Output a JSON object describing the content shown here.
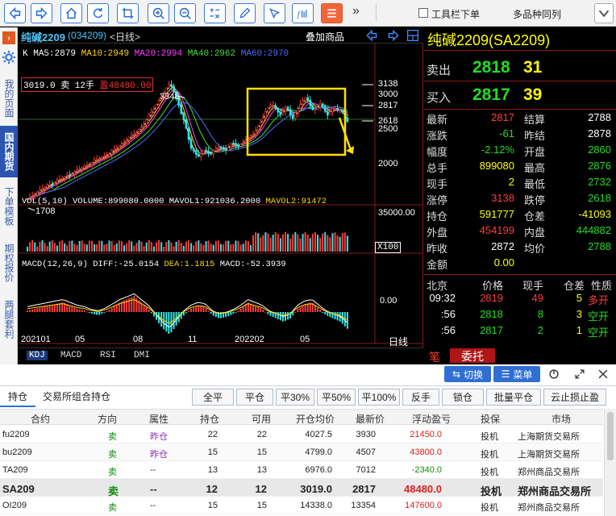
{
  "toolbar": {
    "more": "»",
    "checkbox_label": "工具栏下单",
    "multi_label": "多品种同列",
    "icons": [
      "arrow-left-icon",
      "arrow-right-icon",
      "home-icon",
      "refresh-icon",
      "crop-icon",
      "zoom-in-icon",
      "zoom-out-icon",
      "formula-icon",
      "pencil-icon",
      "pin-icon",
      "fx-icon",
      "list-icon"
    ]
  },
  "sidebar": {
    "items": [
      "我的页面",
      "国内期货",
      "下单模板",
      "期权报价",
      "两腿套利"
    ]
  },
  "chart": {
    "symbol_title": "纯碱2209",
    "symbol_code": "(034209)",
    "period_tag": "<日线>",
    "overlay_label": "叠加商品",
    "ma_legend": {
      "k": "K",
      "ma5": "MA5:2879",
      "ma10": "MA10:2949",
      "ma20": "MA20:2994",
      "ma40": "MA40:2962",
      "ma60": "MA60:2970"
    },
    "position_tag": {
      "text": "3019.0 卖 12手",
      "pnl": "盈48480.00"
    },
    "high_label": "3348",
    "low_label": "1708",
    "price_ticks": [
      "3138",
      "3000",
      "2817",
      "2618",
      "2500",
      "2000"
    ],
    "vol_legend": {
      "a": "VOL(5,10) VOLUME:899080.0000 MAVOL1:921036.2000",
      "b": "MAVOL2:91472"
    },
    "vol_tick": "35000.00",
    "vol_scale": "X100",
    "macd_legend": {
      "a": "MACD(12,26,9) DIFF:-25.0154",
      "dea": "DEA:1.1815",
      "macd": "MACD:-52.3939"
    },
    "macd_tick": "0.00",
    "x_labels": [
      "202101",
      "05",
      "08",
      "11",
      "202202",
      "05"
    ],
    "period_label": "日线",
    "indicator_tabs": [
      "KDJ",
      "MACD",
      "RSI",
      "DMI"
    ]
  },
  "chart_data": {
    "type": "candlestick",
    "title": "纯碱2209",
    "x_ticks": [
      "202101",
      "05",
      "08",
      "11",
      "202202",
      "05"
    ],
    "y_ticks": [
      2000,
      2500,
      3000
    ],
    "annotations": {
      "high": 3348,
      "low": 1708,
      "levels": [
        3138,
        3000,
        2817,
        2618
      ]
    },
    "price_path": [
      1708,
      1780,
      1850,
      1900,
      1950,
      2000,
      2050,
      2100,
      2150,
      2200,
      2260,
      2300,
      2350,
      2420,
      2500,
      2580,
      2650,
      2750,
      2900,
      3050,
      3200,
      3348,
      3100,
      2800,
      2450,
      2300,
      2400,
      2350,
      2450,
      2400,
      2500,
      2450,
      2550,
      2600,
      2750,
      2950,
      3050,
      2900,
      3000,
      2850,
      3050,
      3138,
      2950,
      3050,
      2900,
      3000,
      2950,
      2817
    ],
    "macd_hist": [
      5,
      10,
      15,
      20,
      25,
      30,
      20,
      10,
      5,
      -5,
      -10,
      0,
      15,
      30,
      40,
      50,
      30,
      10,
      -20,
      -50,
      -70,
      -40,
      -10,
      10,
      20,
      15,
      -10,
      -20,
      -15,
      -5,
      10,
      30,
      20,
      10,
      -10,
      -20,
      -30,
      -20,
      10,
      25,
      30,
      10,
      -10,
      -20,
      -30,
      -52
    ]
  },
  "quote": {
    "title": "纯碱2209(SA2209)",
    "sell_label": "卖出",
    "sell_price": "2818",
    "sell_qty": "31",
    "buy_label": "买入",
    "buy_price": "2817",
    "buy_qty": "39",
    "stats": [
      {
        "l1": "最新",
        "v1": "2817",
        "c1": "#ff3c3c",
        "l2": "结算",
        "v2": "2788",
        "c2": "#ffffff"
      },
      {
        "l1": "涨跌",
        "v1": "-61",
        "c1": "#22dd22",
        "l2": "昨结",
        "v2": "2878",
        "c2": "#ffffff"
      },
      {
        "l1": "幅度",
        "v1": "-2.12%",
        "c1": "#22dd22",
        "l2": "开盘",
        "v2": "2860",
        "c2": "#22dd22"
      },
      {
        "l1": "总手",
        "v1": "899080",
        "c1": "#ffff00",
        "l2": "最高",
        "v2": "2876",
        "c2": "#22dd22"
      },
      {
        "l1": "现手",
        "v1": "2",
        "c1": "#ffff00",
        "l2": "最低",
        "v2": "2732",
        "c2": "#22dd22"
      },
      {
        "l1": "涨停",
        "v1": "3138",
        "c1": "#ff3c3c",
        "l2": "跌停",
        "v2": "2618",
        "c2": "#22dd22"
      },
      {
        "l1": "持仓",
        "v1": "591777",
        "c1": "#ffff00",
        "l2": "仓差",
        "v2": "-41093",
        "c2": "#ffff00"
      },
      {
        "l1": "外盘",
        "v1": "454199",
        "c1": "#ff3c3c",
        "l2": "内盘",
        "v2": "444882",
        "c2": "#22dd22"
      },
      {
        "l1": "昨收",
        "v1": "2872",
        "c1": "#ffffff",
        "l2": "均价",
        "v2": "2788",
        "c2": "#22dd22"
      },
      {
        "l1": "金额",
        "v1": "0.00",
        "c1": "#ffff00",
        "l2": "",
        "v2": "",
        "c2": "#ffffff"
      }
    ],
    "tick_header": [
      "北京",
      "价格",
      "现手",
      "仓差",
      "性质"
    ],
    "ticks": [
      {
        "time": "09:32",
        "price": "2819",
        "vol": "49",
        "oi": "5",
        "nature": "多开",
        "pc": "#ff3c3c",
        "vc": "#ff3c3c",
        "nc": "#ff3c3c"
      },
      {
        "time": ":56",
        "price": "2818",
        "vol": "8",
        "oi": "3",
        "nature": "空开",
        "pc": "#22dd22",
        "vc": "#22dd22",
        "nc": "#22dd22"
      },
      {
        "time": ":56",
        "price": "2817",
        "vol": "2",
        "oi": "1",
        "nature": "空开",
        "pc": "#22dd22",
        "vc": "#22dd22",
        "nc": "#22dd22"
      }
    ],
    "bottom_tabs": [
      "笔",
      "委托"
    ]
  },
  "bottom": {
    "switch_label": "切换",
    "menu_label": "菜单",
    "tabs": [
      "持仓",
      "交易所组合持仓"
    ],
    "actions": [
      "全平",
      "平仓",
      "平30%",
      "平50%",
      "平100%",
      "反手",
      "锁仓",
      "批量平仓",
      "云止损止盈"
    ],
    "headers": [
      "合约",
      "方向",
      "属性",
      "持仓",
      "可用",
      "开仓均价",
      "最新价",
      "浮动盈亏",
      "投保",
      "市场"
    ],
    "rows": [
      {
        "contract": "fu2209",
        "dir": "卖",
        "attr": "昨仓",
        "pos": "22",
        "avail": "22",
        "avg": "4027.5",
        "last": "3930",
        "pnl": "21450.0",
        "pnl_color": "#e02020",
        "hedge": "投机",
        "market": "上海期货交易所",
        "bold": false
      },
      {
        "contract": "bu2209",
        "dir": "卖",
        "attr": "昨仓",
        "pos": "15",
        "avail": "15",
        "avg": "4799.0",
        "last": "4507",
        "pnl": "43800.0",
        "pnl_color": "#e02020",
        "hedge": "投机",
        "market": "上海期货交易所",
        "bold": false
      },
      {
        "contract": "TA209",
        "dir": "卖",
        "attr": "--",
        "pos": "13",
        "avail": "13",
        "avg": "6976.0",
        "last": "7012",
        "pnl": "-2340.0",
        "pnl_color": "#108a10",
        "hedge": "投机",
        "market": "郑州商品交易所",
        "bold": false
      },
      {
        "contract": "SA209",
        "dir": "卖",
        "attr": "--",
        "pos": "12",
        "avail": "12",
        "avg": "3019.0",
        "last": "2817",
        "pnl": "48480.0",
        "pnl_color": "#e02020",
        "hedge": "投机",
        "market": "郑州商品交易所",
        "bold": true
      },
      {
        "contract": "OI209",
        "dir": "卖",
        "attr": "--",
        "pos": "15",
        "avail": "15",
        "avg": "14338.0",
        "last": "13354",
        "pnl": "147600.0",
        "pnl_color": "#e02020",
        "hedge": "投机",
        "market": "郑州商品交易所",
        "bold": false
      }
    ]
  }
}
